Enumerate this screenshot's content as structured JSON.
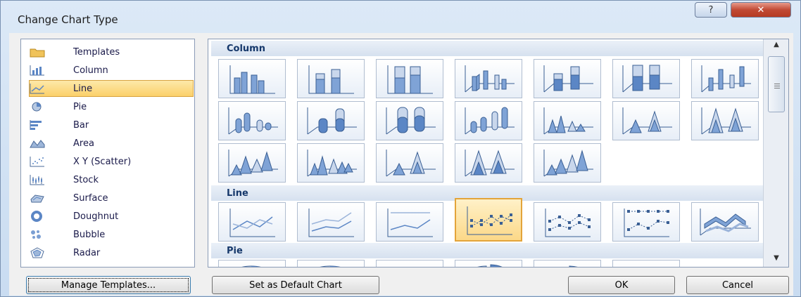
{
  "window": {
    "title": "Change Chart Type",
    "help_label": "?",
    "close_label": "✕"
  },
  "chart_types": [
    {
      "label": "Templates",
      "icon": "folder-icon"
    },
    {
      "label": "Column",
      "icon": "column-chart-icon"
    },
    {
      "label": "Line",
      "icon": "line-chart-icon",
      "selected": true
    },
    {
      "label": "Pie",
      "icon": "pie-chart-icon"
    },
    {
      "label": "Bar",
      "icon": "bar-chart-icon"
    },
    {
      "label": "Area",
      "icon": "area-chart-icon"
    },
    {
      "label": "X Y (Scatter)",
      "icon": "scatter-chart-icon"
    },
    {
      "label": "Stock",
      "icon": "stock-chart-icon"
    },
    {
      "label": "Surface",
      "icon": "surface-chart-icon"
    },
    {
      "label": "Doughnut",
      "icon": "doughnut-chart-icon"
    },
    {
      "label": "Bubble",
      "icon": "bubble-chart-icon"
    },
    {
      "label": "Radar",
      "icon": "radar-chart-icon"
    }
  ],
  "gallery": {
    "sections": [
      {
        "title": "Column"
      },
      {
        "title": "Line"
      },
      {
        "title": "Pie"
      }
    ],
    "selected": "line-with-markers"
  },
  "buttons": {
    "manage_templates": "Manage Templates...",
    "set_default": "Set as Default Chart",
    "ok": "OK",
    "cancel": "Cancel"
  },
  "colors": {
    "accent": "#3a6fb0",
    "selection": "#fbd06a",
    "chart_blue": "#5b86c5"
  }
}
